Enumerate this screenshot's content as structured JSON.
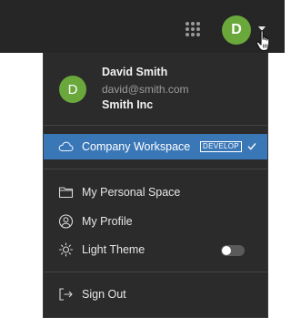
{
  "topbar": {
    "apps_icon": "apps-grid-icon",
    "avatar_initial": "D",
    "avatar_color": "#6aa83c"
  },
  "menu": {
    "user": {
      "initial": "D",
      "name": "David Smith",
      "email": "david@smith.com",
      "organization": "Smith Inc"
    },
    "workspace": {
      "label": "Company Workspace",
      "badge": "DEVELOP",
      "selected": true,
      "icon": "cloud-icon"
    },
    "items": [
      {
        "label": "My Personal Space",
        "icon": "folder-icon"
      },
      {
        "label": "My Profile",
        "icon": "user-circle-icon"
      },
      {
        "label": "Light Theme",
        "icon": "sun-icon",
        "toggle_on": false
      }
    ],
    "sign_out": {
      "label": "Sign Out",
      "icon": "sign-out-icon"
    }
  },
  "colors": {
    "topbar_bg": "#262626",
    "menu_bg": "#2b2b2b",
    "active_bg": "#3a77b7",
    "avatar": "#6aa83c"
  }
}
